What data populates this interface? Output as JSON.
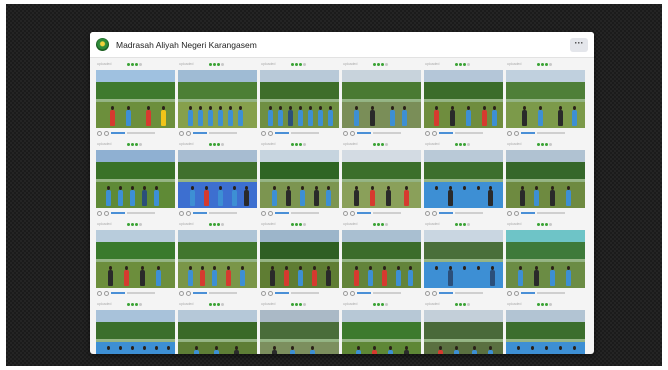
{
  "page": {
    "title": "Madrasah Aliyah Negeri Karangasem",
    "more_label": "···"
  },
  "tile_meta_label": "uploaded",
  "colors": {
    "frame_bg": "#1b1b1b",
    "window_bg": "#f4f4f4",
    "accent_green": "#3aa335",
    "uniform_blue": "#3d8fd4",
    "scout_red": "#d63a2f"
  },
  "tiles": [
    {
      "sky": "#9fc1e0",
      "trees": "#3f7a2e",
      "ground": "#6c8f3c",
      "people": [
        [
          "#d63a2f",
          14
        ],
        [
          "#3d8fd4",
          30
        ],
        [
          "#d63a2f",
          50
        ],
        [
          "#f0c419",
          65
        ]
      ],
      "rating": 3
    },
    {
      "sky": "#9fbbd4",
      "trees": "#4c7f35",
      "ground": "#86a04c",
      "people": [
        [
          "#3d8fd4",
          10
        ],
        [
          "#3d8fd4",
          20
        ],
        [
          "#3d8fd4",
          30
        ],
        [
          "#3d8fd4",
          40
        ],
        [
          "#3d8fd4",
          50
        ],
        [
          "#3d8fd4",
          60
        ]
      ],
      "rating": 3
    },
    {
      "sky": "#b8c9d8",
      "trees": "#3e6e2a",
      "ground": "#6f8f42",
      "people": [
        [
          "#3d8fd4",
          8
        ],
        [
          "#3d8fd4",
          18
        ],
        [
          "#2b4f7a",
          28
        ],
        [
          "#3d8fd4",
          38
        ],
        [
          "#3d8fd4",
          48
        ],
        [
          "#3d8fd4",
          58
        ],
        [
          "#3d8fd4",
          68
        ]
      ],
      "rating": 3
    },
    {
      "sky": "#c8d3dc",
      "trees": "#4a7a32",
      "ground": "#7a8e58",
      "people": [
        [
          "#3d8fd4",
          12
        ],
        [
          "#2a2a2a",
          28
        ],
        [
          "#3d8fd4",
          48
        ],
        [
          "#3d8fd4",
          60
        ]
      ],
      "rating": 3
    },
    {
      "sky": "#b4c6d8",
      "trees": "#3b6c2a",
      "ground": "#6f8d3e",
      "people": [
        [
          "#d63a2f",
          10
        ],
        [
          "#2a2a2a",
          26
        ],
        [
          "#3d8fd4",
          42
        ],
        [
          "#d63a2f",
          58
        ],
        [
          "#3d8fd4",
          68
        ]
      ],
      "rating": 3
    },
    {
      "sky": "#c0d0de",
      "trees": "#4f7f38",
      "ground": "#7c9a4a",
      "people": [
        [
          "#2a2a2a",
          16
        ],
        [
          "#3d8fd4",
          32
        ],
        [
          "#2a2a2a",
          52
        ],
        [
          "#3d8fd4",
          66
        ]
      ],
      "rating": 3
    },
    {
      "sky": "#8fb0d2",
      "trees": "#3a7228",
      "ground": "#5f8a36",
      "people": [
        [
          "#3d8fd4",
          10
        ],
        [
          "#3d8fd4",
          22
        ],
        [
          "#3d8fd4",
          34
        ],
        [
          "#2b4f7a",
          46
        ],
        [
          "#3d8fd4",
          58
        ]
      ],
      "rating": 3
    },
    {
      "sky": "#a7bcd1",
      "trees": "#40702d",
      "ground": "#3d6fd0",
      "people": [
        [
          "#3d8fd4",
          12
        ],
        [
          "#d63a2f",
          26
        ],
        [
          "#3d8fd4",
          40
        ],
        [
          "#3d8fd4",
          54
        ],
        [
          "#2a2a2a",
          66
        ]
      ],
      "rating": 3
    },
    {
      "sky": "#c6d4df",
      "trees": "#2f6524",
      "ground": "#7c9550",
      "people": [
        [
          "#3d8fd4",
          12
        ],
        [
          "#2a2a2a",
          26
        ],
        [
          "#3d8fd4",
          40
        ],
        [
          "#2a2a2a",
          54
        ],
        [
          "#3d8fd4",
          66
        ]
      ],
      "rating": 3
    },
    {
      "sky": "#d3dbe3",
      "trees": "#3b6f2b",
      "ground": "#8aa05a",
      "people": [
        [
          "#2a2a2a",
          12
        ],
        [
          "#d63a2f",
          28
        ],
        [
          "#2a2a2a",
          44
        ],
        [
          "#d63a2f",
          62
        ]
      ],
      "rating": 3
    },
    {
      "sky": "#b9c9d7",
      "trees": "#3d6f2d",
      "ground": "#3d8fd4",
      "people": [
        [
          "#3d8fd4",
          10
        ],
        [
          "#2a2a2a",
          24
        ],
        [
          "#3d8fd4",
          38
        ],
        [
          "#3d8fd4",
          52
        ],
        [
          "#2a2a2a",
          64
        ]
      ],
      "rating": 3
    },
    {
      "sky": "#b0c2d2",
      "trees": "#36672a",
      "ground": "#6e8a40",
      "people": [
        [
          "#2a2a2a",
          14
        ],
        [
          "#3d8fd4",
          28
        ],
        [
          "#2a2a2a",
          44
        ],
        [
          "#3d8fd4",
          60
        ]
      ],
      "rating": 3
    },
    {
      "sky": "#b8ccdc",
      "trees": "#3a7a2c",
      "ground": "#6c8e3c",
      "people": [
        [
          "#2a2a2a",
          12
        ],
        [
          "#d63a2f",
          28
        ],
        [
          "#2a2a2a",
          44
        ],
        [
          "#3d8fd4",
          60
        ]
      ],
      "rating": 3
    },
    {
      "sky": "#aec4d6",
      "trees": "#41762e",
      "ground": "#7a9648",
      "people": [
        [
          "#3d8fd4",
          10
        ],
        [
          "#d63a2f",
          22
        ],
        [
          "#3d8fd4",
          34
        ],
        [
          "#d63a2f",
          48
        ],
        [
          "#3d8fd4",
          62
        ]
      ],
      "rating": 3
    },
    {
      "sky": "#9cb5ca",
      "trees": "#2f5f23",
      "ground": "#5f7d33",
      "people": [
        [
          "#2a2a2a",
          10
        ],
        [
          "#d63a2f",
          24
        ],
        [
          "#3d8fd4",
          38
        ],
        [
          "#d63a2f",
          52
        ],
        [
          "#2a2a2a",
          66
        ]
      ],
      "rating": 3
    },
    {
      "sky": "#a9bfd1",
      "trees": "#3b6c2b",
      "ground": "#63843a",
      "people": [
        [
          "#d63a2f",
          12
        ],
        [
          "#3d8fd4",
          26
        ],
        [
          "#d63a2f",
          40
        ],
        [
          "#3d8fd4",
          54
        ],
        [
          "#3d8fd4",
          66
        ]
      ],
      "rating": 3
    },
    {
      "sky": "#c9d6e1",
      "trees": "#4a6f3a",
      "ground": "#3d8fd4",
      "people": [
        [
          "#3d8fd4",
          10
        ],
        [
          "#2b4f7a",
          24
        ],
        [
          "#3d8fd4",
          38
        ],
        [
          "#3d8fd4",
          52
        ],
        [
          "#2b4f7a",
          66
        ]
      ],
      "rating": 3
    },
    {
      "sky": "#6ec4c7",
      "trees": "#3e7a3a",
      "ground": "#6b8c44",
      "people": [
        [
          "#3d8fd4",
          12
        ],
        [
          "#2a2a2a",
          28
        ],
        [
          "#3d8fd4",
          44
        ],
        [
          "#3d8fd4",
          60
        ]
      ],
      "rating": 3
    },
    {
      "sky": "#a8c2da",
      "trees": "#3b6f2c",
      "ground": "#3d8fd4",
      "people": [
        [
          "#3d8fd4",
          10
        ],
        [
          "#3d8fd4",
          22
        ],
        [
          "#3d8fd4",
          34
        ],
        [
          "#3d8fd4",
          46
        ],
        [
          "#3d8fd4",
          58
        ],
        [
          "#3d8fd4",
          70
        ]
      ],
      "rating": 3
    },
    {
      "sky": "#b5c8d8",
      "trees": "#3a6a28",
      "ground": "#5e7e36",
      "people": [
        [
          "#3d8fd4",
          16
        ],
        [
          "#3d8fd4",
          36
        ],
        [
          "#2a2a2a",
          56
        ]
      ],
      "rating": 3
    },
    {
      "sky": "#aab9c6",
      "trees": "#4a6d3a",
      "ground": "#7c8f5e",
      "people": [
        [
          "#2a2a2a",
          12
        ],
        [
          "#3d8fd4",
          30
        ],
        [
          "#3d8fd4",
          50
        ]
      ],
      "rating": 3
    },
    {
      "sky": "#b7c8d6",
      "trees": "#3d7a2e",
      "ground": "#5e8736",
      "people": [
        [
          "#3d8fd4",
          14
        ],
        [
          "#d63a2f",
          30
        ],
        [
          "#3d8fd4",
          46
        ],
        [
          "#2a2a2a",
          62
        ]
      ],
      "rating": 3
    },
    {
      "sky": "#c3cfd9",
      "trees": "#4a6a3a",
      "ground": "#5a7040",
      "people": [
        [
          "#d63a2f",
          14
        ],
        [
          "#3d8fd4",
          30
        ],
        [
          "#3d8fd4",
          48
        ],
        [
          "#3d8fd4",
          64
        ]
      ],
      "rating": 3
    },
    {
      "sky": "#b2c4d3",
      "trees": "#3c6e2d",
      "ground": "#3d8fd4",
      "people": [
        [
          "#3d8fd4",
          10
        ],
        [
          "#3d8fd4",
          24
        ],
        [
          "#3d8fd4",
          38
        ],
        [
          "#3d8fd4",
          52
        ],
        [
          "#3d8fd4",
          66
        ]
      ],
      "rating": 3
    }
  ]
}
